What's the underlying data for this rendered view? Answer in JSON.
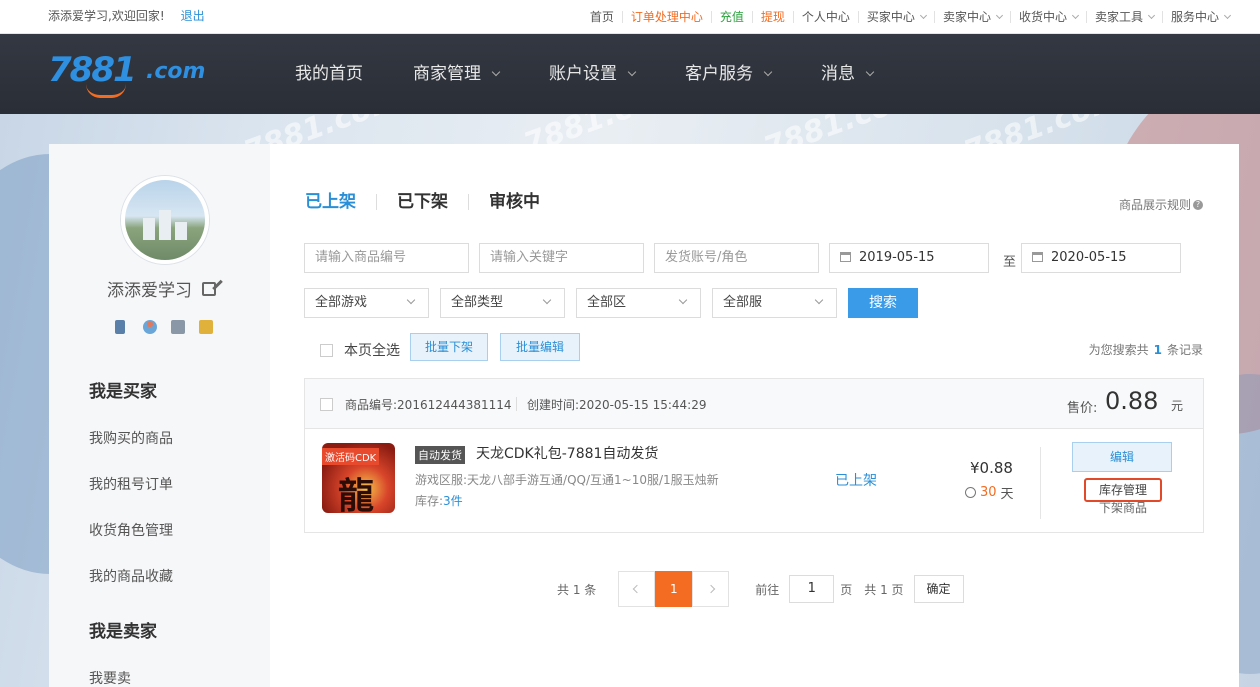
{
  "topbar": {
    "greeting": "添添爱学习,欢迎回家!",
    "logout": "退出",
    "links": [
      {
        "label": "首页",
        "style": "normal",
        "dropdown": false
      },
      {
        "label": "订单处理中心",
        "style": "orange",
        "dropdown": false
      },
      {
        "label": "充值",
        "style": "green",
        "dropdown": false
      },
      {
        "label": "提现",
        "style": "orange",
        "dropdown": false
      },
      {
        "label": "个人中心",
        "style": "normal",
        "dropdown": false
      },
      {
        "label": "买家中心",
        "style": "normal",
        "dropdown": true
      },
      {
        "label": "卖家中心",
        "style": "normal",
        "dropdown": true
      },
      {
        "label": "收货中心",
        "style": "normal",
        "dropdown": true
      },
      {
        "label": "卖家工具",
        "style": "normal",
        "dropdown": true
      },
      {
        "label": "服务中心",
        "style": "normal",
        "dropdown": true
      }
    ]
  },
  "header": {
    "logo_num": "7881",
    "logo_dom": ".com",
    "nav": [
      {
        "label": "我的首页",
        "dropdown": false
      },
      {
        "label": "商家管理",
        "dropdown": true
      },
      {
        "label": "账户设置",
        "dropdown": true
      },
      {
        "label": "客户服务",
        "dropdown": true
      },
      {
        "label": "消息",
        "dropdown": true
      }
    ]
  },
  "sidebar": {
    "username": "添添爱学习",
    "buyer_title": "我是买家",
    "buyer_items": [
      "我购买的商品",
      "我的租号订单",
      "收货角色管理",
      "我的商品收藏"
    ],
    "seller_title": "我是卖家",
    "seller_items": [
      "我要卖"
    ]
  },
  "tabs": [
    "已上架",
    "已下架",
    "审核中"
  ],
  "rules": "商品展示规则",
  "filters": {
    "product_no": "请输入商品编号",
    "keyword": "请输入关键字",
    "account": "发货账号/角色",
    "date_from": "2019-05-15",
    "to": "至",
    "date_to": "2020-05-15",
    "game": "全部游戏",
    "type": "全部类型",
    "zone": "全部区",
    "server": "全部服",
    "search": "搜索"
  },
  "bulk": {
    "select_all": "本页全选",
    "off_shelf": "批量下架",
    "edit": "批量编辑",
    "records_prefix": "为您搜索共",
    "records_count": "1",
    "records_suffix": "条记录"
  },
  "item": {
    "product_no": "商品编号:201612444381114",
    "created": "创建时间:2020-05-15 15:44:29",
    "price_label": "售价:",
    "price": "0.88",
    "unit": "元",
    "thumb_tag": "激活码CDK",
    "thumb_char": "龍",
    "auto_tag": "自动发货",
    "title": "天龙CDK礼包-7881自动发货",
    "area": "游戏区服:天龙八部手游互通/QQ/互通1~10服/1服玉烛新",
    "stock_label": "库存:",
    "stock_value": "3件",
    "status": "已上架",
    "unit_price": "¥0.88",
    "days_num": "30",
    "days_unit": "天",
    "edit": "编辑",
    "stock_mgmt": "库存管理",
    "take_down": "下架商品"
  },
  "pager": {
    "total": "共 1 条",
    "current": "1",
    "goto": "前往",
    "page_value": "1",
    "page_unit": "页",
    "total_pages": "共 1 页",
    "confirm": "确定"
  },
  "colors": {
    "accent": "#2a8fd6",
    "orange": "#f36c21",
    "header": "#2f333b"
  }
}
